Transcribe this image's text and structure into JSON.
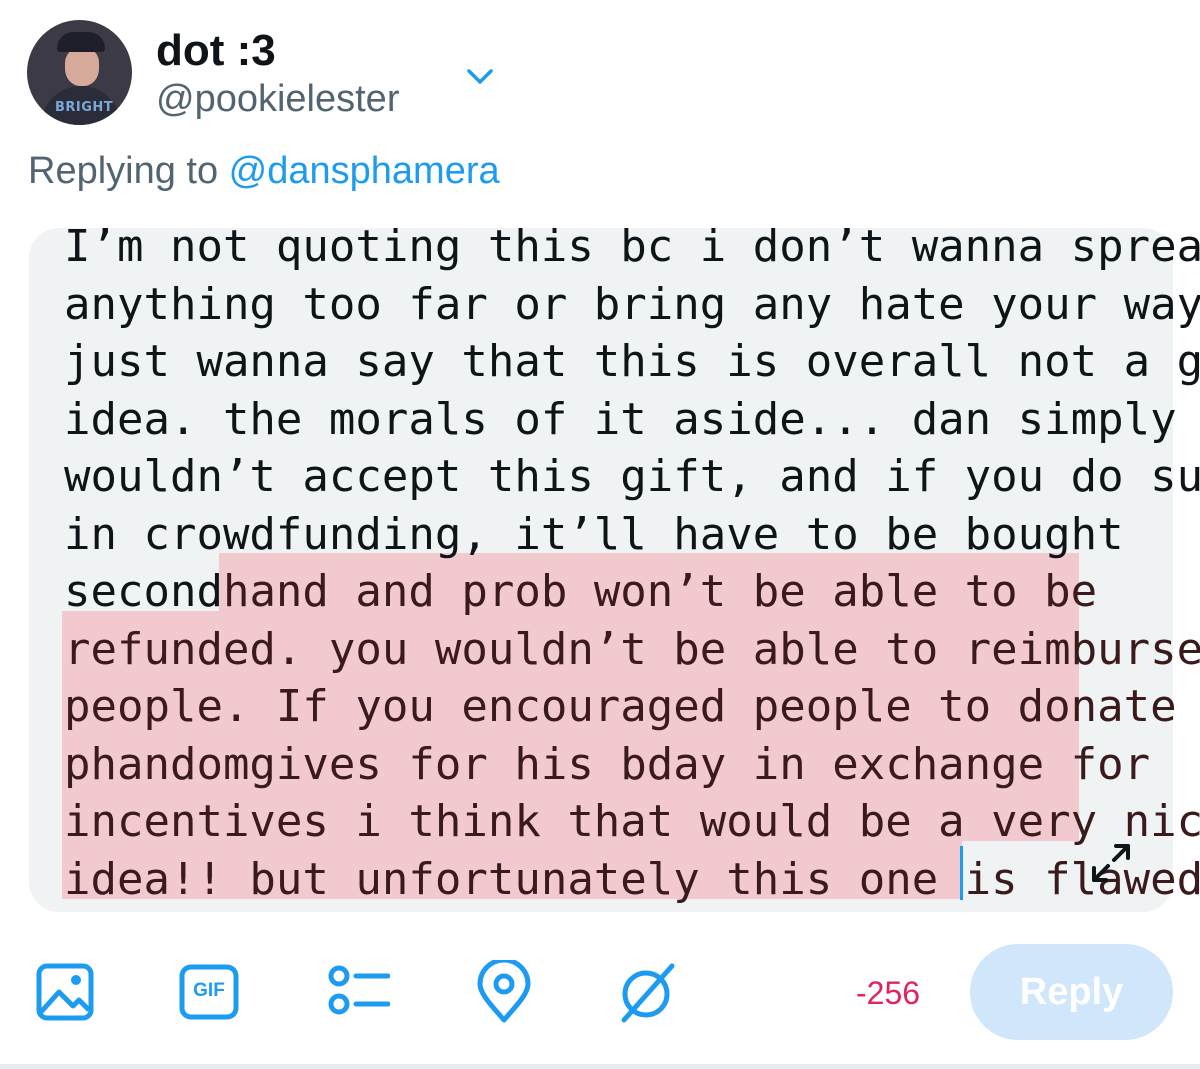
{
  "header": {
    "display_name": "dot :3",
    "handle": "@pookielester",
    "avatar_brand_text": "BRIGHT"
  },
  "replying": {
    "prefix": "Replying to ",
    "mention": "@dansphamera"
  },
  "compose": {
    "lines": [
      "I’m not quoting this bc i don’t wanna spread",
      "anything too far or bring any hate your way but i",
      "just wanna say that this is overall not a good",
      "idea. the morals of it aside... dan simply",
      "wouldn’t accept this gift, and if you do succeed",
      "in crowdfunding, it’ll have to be bought",
      "second",
      "hand and prob won’t be able to be",
      "refunded. you wouldn’t be able to reimburse",
      "people. If you encouraged people to donate to",
      "phandomgives for his bday in exchange for",
      "incentives i think that would be a very nice",
      "idea!! but unfortunately this one is flawed."
    ]
  },
  "toolbar": {
    "icons": [
      "image-icon",
      "gif-icon",
      "poll-icon",
      "location-icon",
      "schedule-icon"
    ],
    "gif_label": "GIF",
    "char_counter": "-256",
    "reply_label": "Reply"
  },
  "colors": {
    "accent": "#1d9bf0",
    "highlight": "#f1c9cf",
    "counter_error": "#e0245e",
    "reply_disabled": "#cfe6fb"
  }
}
